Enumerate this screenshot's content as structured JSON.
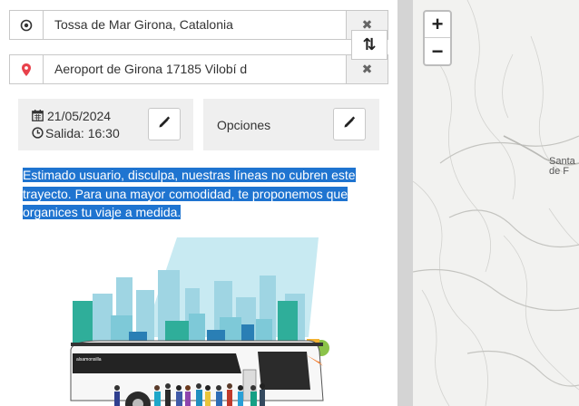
{
  "route": {
    "origin": "Tossa de Mar Girona, Catalonia",
    "destination": "Aeroport de Girona 17185 Vilobí d",
    "clear_symbol": "✖",
    "swap_symbol": "⇅"
  },
  "trip": {
    "date": "21/05/2024",
    "departure": "Salida: 16:30",
    "options_label": "Opciones"
  },
  "notice": "Estimado usuario, disculpa, nuestras líneas no cubren este trayecto. Para una mayor comodidad, te proponemos que organices tu viaje a medida.",
  "bus_brand": "alsamonsilla",
  "map": {
    "zoom_in": "+",
    "zoom_out": "−",
    "label_line1": "Santa",
    "label_line2": "de F"
  },
  "icons": {
    "origin": "target-icon",
    "destination": "map-pin-icon",
    "date": "calendar-icon",
    "time": "clock-icon",
    "edit": "pencil-icon"
  },
  "colors": {
    "pin": "#e8414b",
    "selection": "#1f74d0",
    "card_bg": "#efefef"
  }
}
